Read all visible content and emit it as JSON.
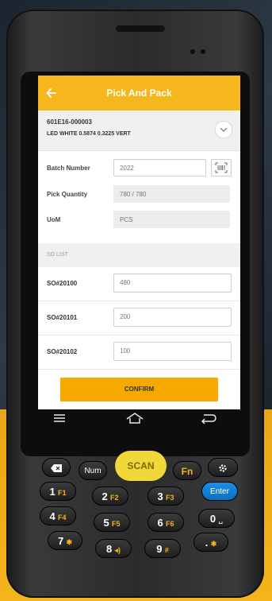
{
  "app": {
    "title": "Pick And Pack",
    "back_icon": "arrow-left-icon"
  },
  "item": {
    "code": "601E16-000003",
    "description": "LED WHITE 0.5874 0.3225 VERT",
    "expand_icon": "chevron-down-icon"
  },
  "form": {
    "batch_label": "Batch Number",
    "batch_value": "2022",
    "batch_scan_icon": "barcode-scan-icon",
    "pick_qty_label": "Pick Quantity",
    "pick_qty_value": "780 / 780",
    "uom_label": "UoM",
    "uom_value": "PCS"
  },
  "so_list": {
    "header": "SO LIST",
    "rows": [
      {
        "so": "SO#20100",
        "qty": "480"
      },
      {
        "so": "SO#20101",
        "qty": "200"
      },
      {
        "so": "SO#20102",
        "qty": "100"
      }
    ]
  },
  "confirm_label": "CONFIRM",
  "nav": {
    "menu_icon": "menu-icon",
    "home_icon": "home-icon",
    "back_icon": "back-icon"
  },
  "keys": {
    "scan": "SCAN",
    "num": "Num",
    "fn": "Fn",
    "enter": "Enter",
    "k1": "1",
    "f1": "F1",
    "k2": "2",
    "f2": "F2",
    "k3": "3",
    "f3": "F3",
    "k4": "4",
    "f4": "F4",
    "k5": "5",
    "f5": "F5",
    "k6": "6",
    "f6": "F6",
    "k0": "0",
    "k7": "7",
    "k8": "8",
    "k9": "9",
    "hash": "#",
    "dot": "."
  },
  "colors": {
    "accent": "#f6b71e",
    "confirm": "#f6a900",
    "enter_key": "#1b8fe6",
    "scan_key": "#f1d838"
  }
}
